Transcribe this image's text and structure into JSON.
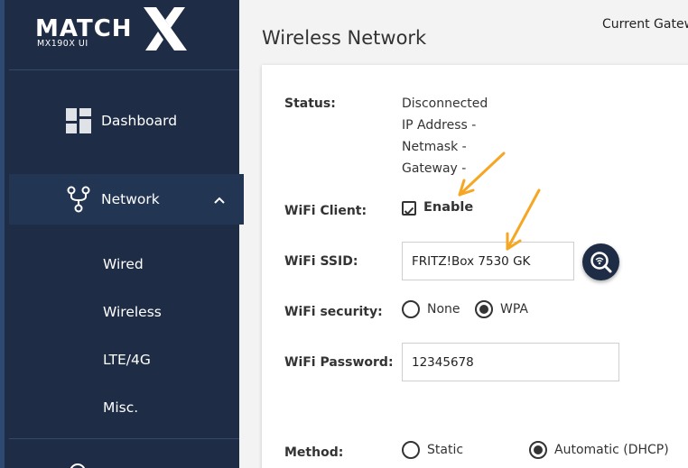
{
  "logo": {
    "brand": "MATCH X",
    "model": "MX190X UI"
  },
  "sidebar": {
    "items": [
      {
        "label": "Dashboard",
        "icon": "dashboard-icon"
      },
      {
        "label": "Network",
        "icon": "network-icon",
        "expanded": true
      }
    ],
    "network_sub": [
      "Wired",
      "Wireless",
      "LTE/4G",
      "Misc."
    ]
  },
  "header": {
    "title": "Wireless Network",
    "gateway": "Current Gateway"
  },
  "form": {
    "status_label": "Status:",
    "status_lines": [
      "Disconnected",
      "IP Address -",
      "Netmask -",
      "Gateway -"
    ],
    "wifi_client_label": "WiFi Client:",
    "enable_label": "Enable",
    "enable_checked": true,
    "ssid_label": "WiFi SSID:",
    "ssid_value": "FRITZ!Box 7530 GK",
    "security_label": "WiFi security:",
    "security_options": [
      "None",
      "WPA"
    ],
    "security_selected": "WPA",
    "password_label": "WiFi Password:",
    "password_value": "12345678",
    "method_label": "Method:",
    "method_options": [
      "Static",
      "Automatic (DHCP)"
    ],
    "method_selected": "Automatic (DHCP)"
  },
  "colors": {
    "sidebar_bg": "#1e2d45",
    "sidebar_active": "#223553",
    "annotation_arrow": "#f5a623"
  }
}
